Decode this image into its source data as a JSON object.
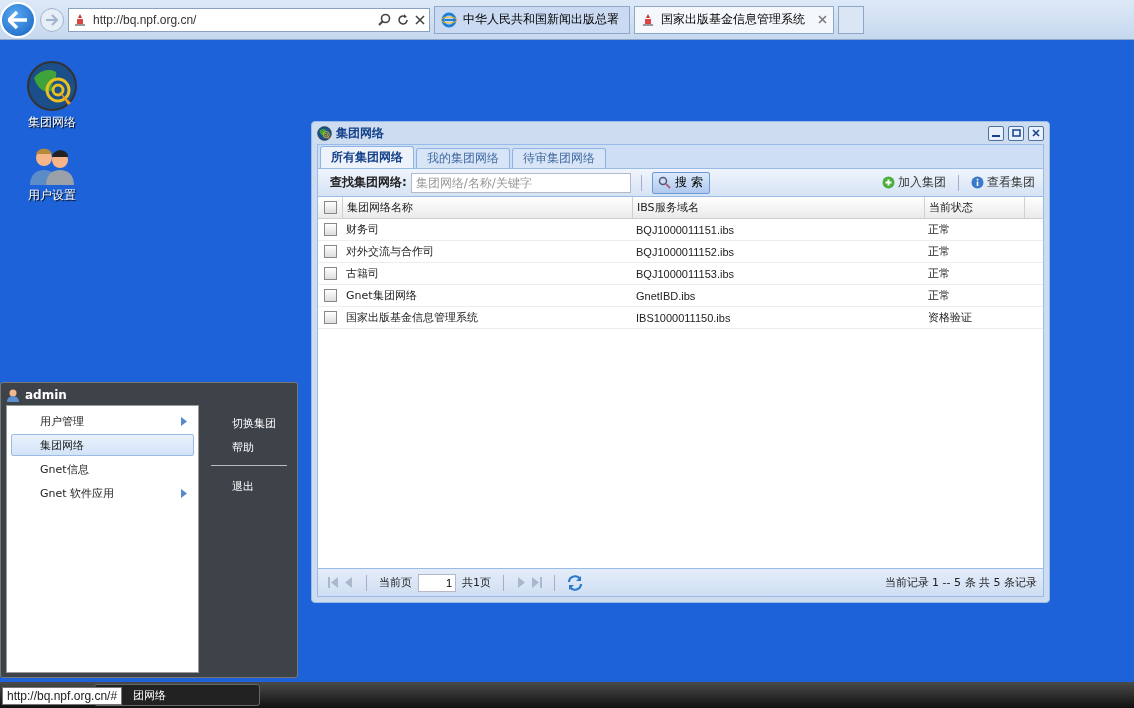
{
  "browser": {
    "url": "http://bq.npf.org.cn/",
    "tabs": [
      {
        "title": "中华人民共和国新闻出版总署",
        "kind": "ie",
        "selected": false
      },
      {
        "title": "国家出版基金信息管理系统",
        "kind": "site",
        "selected": true
      }
    ]
  },
  "desktop_icons": [
    {
      "label": "集团网络",
      "kind": "globe"
    },
    {
      "label": "用户设置",
      "kind": "users"
    }
  ],
  "window": {
    "title": "集团网络",
    "tabs": [
      {
        "label": "所有集团网络",
        "selected": true
      },
      {
        "label": "我的集团网络",
        "selected": false
      },
      {
        "label": "待审集团网络",
        "selected": false
      }
    ],
    "search": {
      "label": "查找集团网络:",
      "placeholder": "集团网络/名称/关键字",
      "button": "搜 索"
    },
    "actions": [
      {
        "label": "加入集团",
        "kind": "add"
      },
      {
        "label": "查看集团",
        "kind": "info"
      }
    ],
    "table": {
      "all_checked": false,
      "columns": [
        "集团网络名称",
        "IBS服务域名",
        "当前状态"
      ],
      "rows": [
        {
          "checked": false,
          "cells": [
            "财务司",
            "BQJ1000011151.ibs",
            "正常"
          ]
        },
        {
          "checked": false,
          "cells": [
            "对外交流与合作司",
            "BQJ1000011152.ibs",
            "正常"
          ]
        },
        {
          "checked": false,
          "cells": [
            "古籍司",
            "BQJ1000011153.ibs",
            "正常"
          ]
        },
        {
          "checked": false,
          "cells": [
            "Gnet集团网络",
            "GnetIBD.ibs",
            "正常"
          ]
        },
        {
          "checked": false,
          "cells": [
            "国家出版基金信息管理系统",
            "IBS1000011150.ibs",
            "资格验证"
          ]
        }
      ]
    },
    "pager": {
      "page_label": "当前页",
      "page": "1",
      "total": "共1页",
      "summary": "当前记录 1 -- 5 条 共 5 条记录"
    }
  },
  "start_menu": {
    "user": "admin",
    "items": [
      {
        "label": "用户管理",
        "selected": false,
        "submenu": true
      },
      {
        "label": "集团网络",
        "selected": true,
        "submenu": false
      },
      {
        "label": "Gnet信息",
        "selected": false,
        "submenu": false
      },
      {
        "label": "Gnet 软件应用",
        "selected": false,
        "submenu": true
      }
    ],
    "side_groups": [
      [
        "切换集团",
        "帮助"
      ],
      [
        "退出"
      ]
    ]
  },
  "taskbar": {
    "items": [
      {
        "label": "团网络"
      }
    ],
    "status_url": "http://bq.npf.org.cn/#"
  }
}
